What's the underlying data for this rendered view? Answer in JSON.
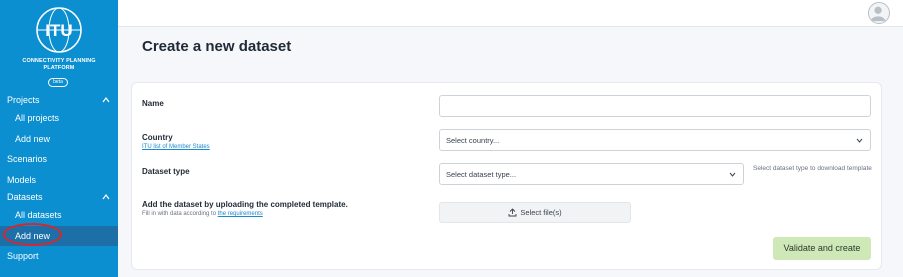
{
  "sidebar": {
    "logo_text": "ITU",
    "platform_name_line1": "CONNECTIVITY PLANNING",
    "platform_name_line2": "PLATFORM",
    "beta_badge": "beta",
    "items": [
      {
        "label": "Projects"
      },
      {
        "label": "All projects"
      },
      {
        "label": "Add new"
      },
      {
        "label": "Scenarios"
      },
      {
        "label": "Models"
      },
      {
        "label": "Datasets"
      },
      {
        "label": "All datasets"
      },
      {
        "label": "Add new"
      },
      {
        "label": "Support"
      }
    ],
    "highlight_color": "#d8262b"
  },
  "header": {
    "avatar_icon": "user-avatar-icon"
  },
  "page": {
    "title": "Create a new dataset"
  },
  "form": {
    "name_label": "Name",
    "name_value": "",
    "country_label": "Country",
    "country_link": "ITU list of Member States",
    "country_select": "Select country...",
    "dataset_type_label": "Dataset type",
    "dataset_type_select": "Select dataset type...",
    "dataset_type_hint": "Select dataset type to download template",
    "upload_label": "Add the dataset by uploading the completed template.",
    "upload_helper_prefix": "Fill in with data according to",
    "upload_helper_link": "the requirements",
    "upload_button": "Select file(s)",
    "submit_button": "Validate and create"
  },
  "colors": {
    "sidebar_bg": "#0b8fd0",
    "sidebar_active": "#1d6fa8",
    "submit_bg": "#cfe8b8",
    "link": "#1a8ad0"
  }
}
